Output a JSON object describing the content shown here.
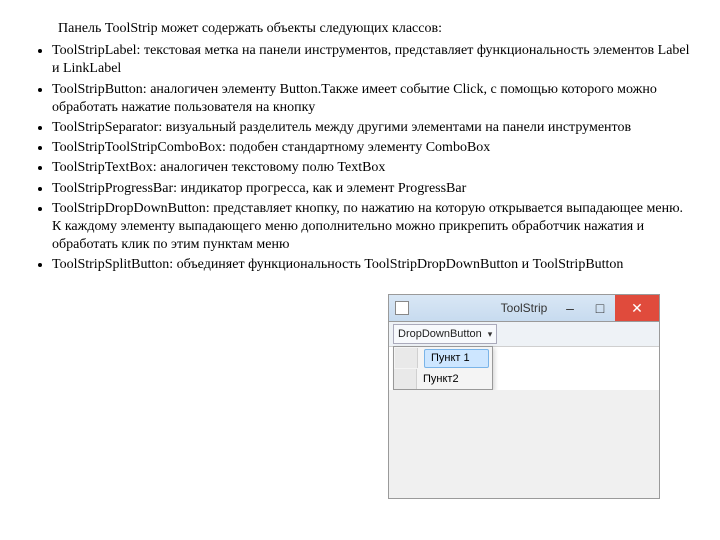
{
  "intro": "Панель ToolStrip может содержать объекты следующих классов:",
  "items": [
    "ToolStripLabel: текстовая метка на панели инструментов, представляет функциональность элементов Label и LinkLabel",
    "ToolStripButton: аналогичен элементу Button.Также имеет событие Click, с помощью которого можно обработать нажатие пользователя на кнопку",
    "ToolStripSeparator: визуальный разделитель между другими элементами на панели инструментов",
    "ToolStripToolStripComboBox: подобен стандартному элементу ComboBox",
    "ToolStripTextBox: аналогичен текстовому полю TextBox",
    "ToolStripProgressBar: индикатор прогресса, как и элемент ProgressBar",
    "ToolStripDropDownButton: представляет кнопку, по нажатию на которую открывается выпадающее меню. К каждому элементу выпадающего меню дополнительно можно прикрепить обработчик нажатия и обработать клик по этим пунктам меню",
    "ToolStripSplitButton: объединяет функциональность ToolStripDropDownButton и ToolStripButton"
  ],
  "window": {
    "title": "ToolStrip",
    "min": "–",
    "max": "□",
    "close": "✕",
    "dropdown_label": "DropDownButton",
    "arrow": "▾",
    "menu1": "Пункт 1",
    "menu2": "Пункт2"
  }
}
